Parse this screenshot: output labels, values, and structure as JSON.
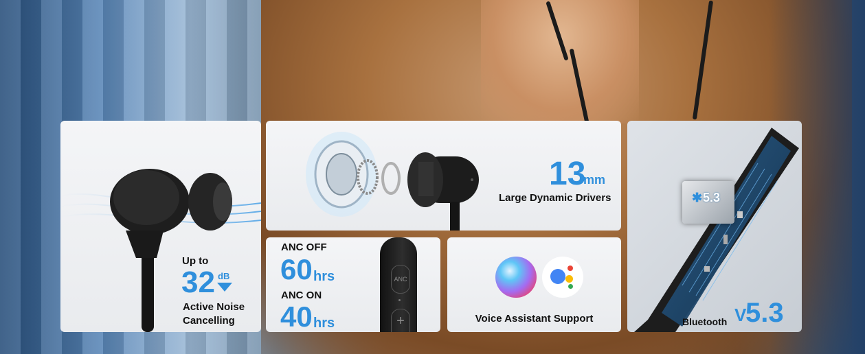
{
  "cards": {
    "anc": {
      "up_to": "Up to",
      "value": "32",
      "unit": "dB",
      "line1": "Active Noise",
      "line2": "Cancelling"
    },
    "drivers": {
      "value": "13",
      "unit": "mm",
      "label": "Large Dynamic Drivers"
    },
    "battery": {
      "off_label": "ANC OFF",
      "off_value": "60",
      "off_unit": "hrs",
      "on_label": "ANC ON",
      "on_value": "40",
      "on_unit": "hrs",
      "button_anc": "ANC",
      "button_plus": "+"
    },
    "assistant": {
      "label": "Voice Assistant Support"
    },
    "bluetooth": {
      "label": "Bluetooth",
      "version_prefix": "V",
      "version": "5.3",
      "chip_text": "5.3"
    }
  },
  "colors": {
    "accent_blue": "#2f8fdc",
    "text_dark": "#111111",
    "card_bg": "#f1f2f4"
  },
  "icons": [
    "siri-icon",
    "google-assistant-icon",
    "bluetooth-icon",
    "arrow-down-icon"
  ]
}
